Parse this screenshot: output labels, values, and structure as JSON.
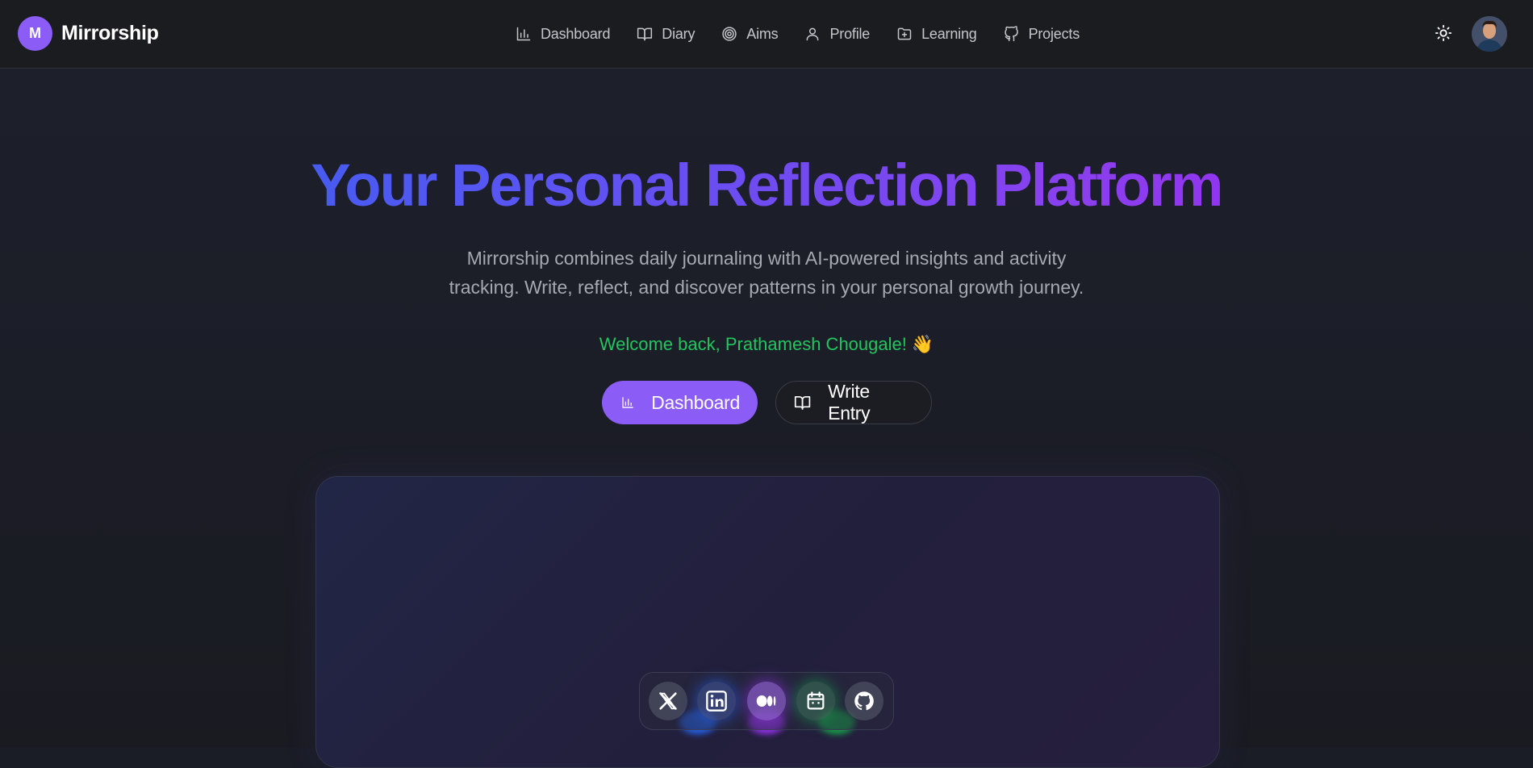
{
  "brand": {
    "logo_letter": "M",
    "name": "Mirrorship"
  },
  "nav": {
    "items": [
      {
        "label": "Dashboard",
        "icon": "bar-chart-icon"
      },
      {
        "label": "Diary",
        "icon": "book-open-icon"
      },
      {
        "label": "Aims",
        "icon": "target-icon"
      },
      {
        "label": "Profile",
        "icon": "user-icon"
      },
      {
        "label": "Learning",
        "icon": "folder-plus-icon"
      },
      {
        "label": "Projects",
        "icon": "github-icon"
      }
    ]
  },
  "header": {
    "theme_icon": "sun-icon",
    "avatar": "user-avatar"
  },
  "hero": {
    "title": "Your Personal Reflection Platform",
    "subtitle_line1": "Mirrorship combines daily journaling with AI-powered insights and activity",
    "subtitle_line2": "tracking. Write, reflect, and discover patterns in your personal growth journey.",
    "welcome": "Welcome back, Prathamesh Chougale!",
    "welcome_emoji": "👋"
  },
  "cta": {
    "primary_label": "Dashboard",
    "secondary_label": "Write Entry"
  },
  "social": [
    {
      "name": "x-icon"
    },
    {
      "name": "linkedin-icon"
    },
    {
      "name": "medium-icon"
    },
    {
      "name": "calendar-icon"
    },
    {
      "name": "github-icon"
    }
  ],
  "colors": {
    "accent": "#8b5cf6",
    "welcome": "#22c55e",
    "title_gradient_start": "#2f63f0",
    "title_gradient_end": "#a020f0"
  }
}
